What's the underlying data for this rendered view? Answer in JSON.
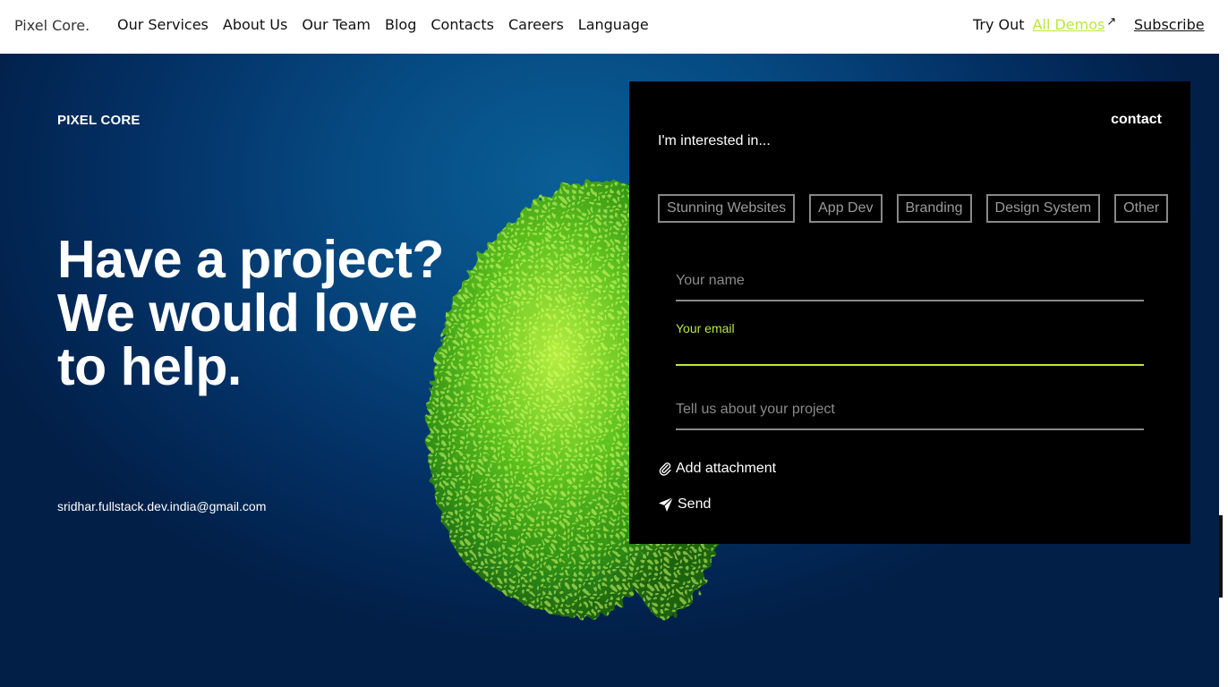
{
  "header": {
    "logo": "Pixel Core.",
    "nav": [
      "Our Services",
      "About Us",
      "Our Team",
      "Blog",
      "Contacts",
      "Careers",
      "Language"
    ],
    "try_out": "Try Out",
    "demos_label": "All Demos",
    "subscribe_label": "Subscribe"
  },
  "hero": {
    "brand": "PIXEL CORE",
    "headline": [
      "Have a project?",
      "We would love",
      "to help."
    ],
    "email": "sridhar.fullstack.dev.india@gmail.com"
  },
  "contact": {
    "title": "contact",
    "interest_label": "I'm interested in...",
    "chips": [
      "Stunning Websites",
      "App Dev",
      "Branding",
      "Design System",
      "Other"
    ],
    "name_placeholder": "Your name",
    "email_label": "Your email",
    "project_placeholder": "Tell us about your project",
    "attachment_label": "Add attachment",
    "send_label": "Send"
  },
  "colors": {
    "accent": "#b9e83a",
    "panel": "#000000",
    "hero": "#064a82"
  },
  "icons": [
    "arrow-up-right-icon",
    "paperclip-icon",
    "send-icon",
    "globe-sphere-icon"
  ]
}
